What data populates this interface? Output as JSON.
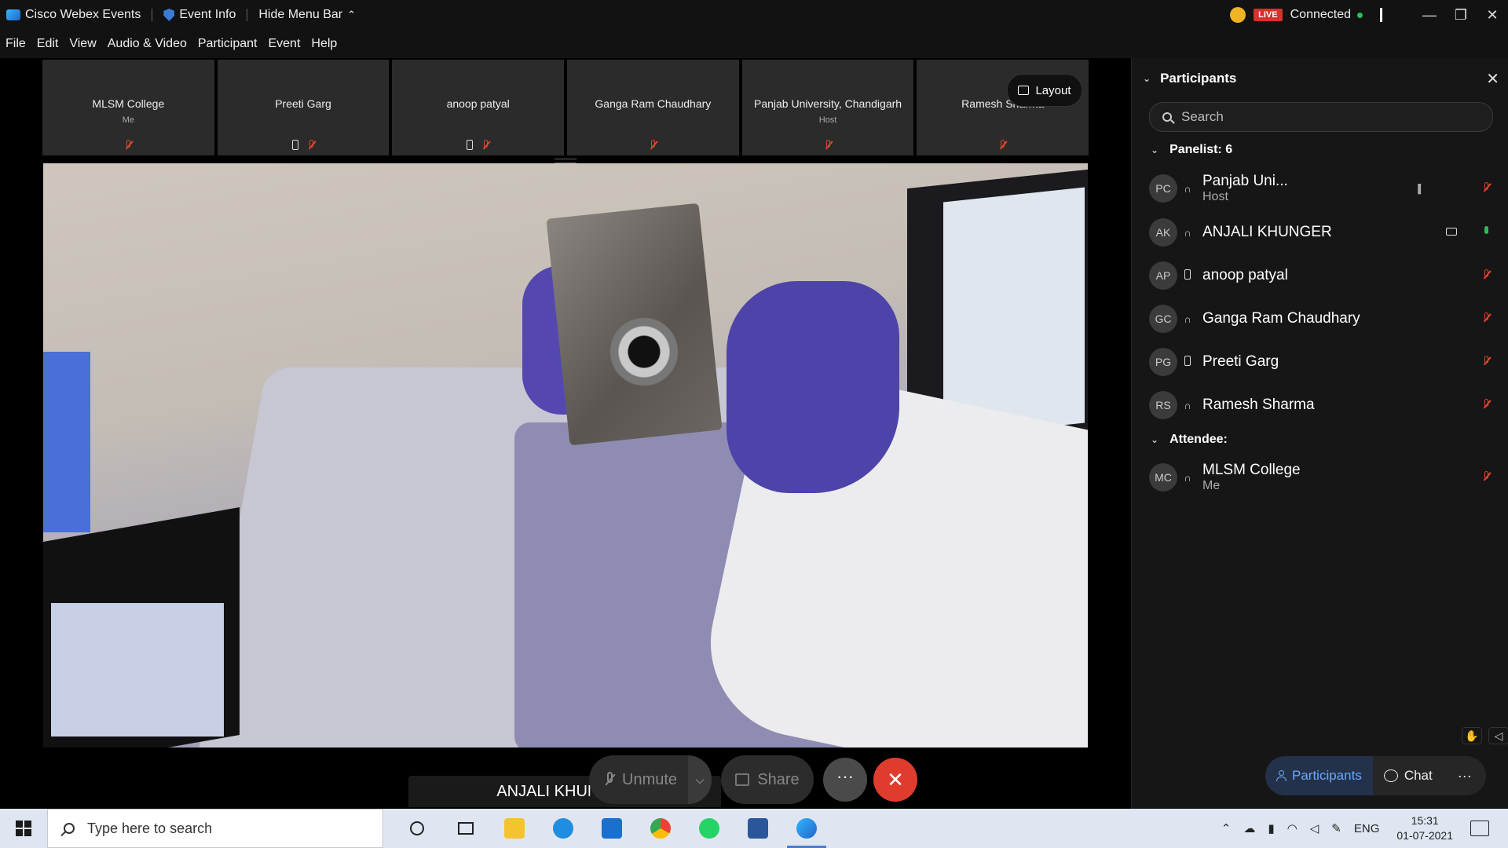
{
  "titlebar": {
    "app_name": "Cisco Webex Events",
    "event_info": "Event Info",
    "hide_menu": "Hide Menu Bar",
    "live": "LIVE",
    "status": "Connected",
    "minimize": "—",
    "restore": "❐",
    "close": "✕"
  },
  "menu": [
    "File",
    "Edit",
    "View",
    "Audio & Video",
    "Participant",
    "Event",
    "Help"
  ],
  "thumbnails": [
    {
      "name": "MLSM College",
      "sub": "Me",
      "phone": false
    },
    {
      "name": "Preeti Garg",
      "sub": "",
      "phone": true
    },
    {
      "name": "anoop patyal",
      "sub": "",
      "phone": true
    },
    {
      "name": "Ganga Ram Chaudhary",
      "sub": "",
      "phone": false
    },
    {
      "name": "Panjab University, Chandigarh",
      "sub": "Host",
      "phone": false
    },
    {
      "name": "Ramesh Sharma",
      "sub": "",
      "phone": false
    }
  ],
  "layout_label": "Layout",
  "active_speaker": "ANJALI KHUNGER",
  "controls": {
    "unmute": "Unmute",
    "share": "Share",
    "more": "···",
    "leave": "✕"
  },
  "panel": {
    "title": "Participants",
    "search_placeholder": "Search",
    "panelist_header": "Panelist: 6",
    "attendee_header": "Attendee:",
    "panelists": [
      {
        "initials": "PC",
        "name": "Panjab Uni...",
        "sub": "Host"
      },
      {
        "initials": "AK",
        "name": "ANJALI KHUNGER",
        "sub": ""
      },
      {
        "initials": "AP",
        "name": "anoop patyal",
        "sub": ""
      },
      {
        "initials": "GC",
        "name": "Ganga Ram Chaudhary",
        "sub": ""
      },
      {
        "initials": "PG",
        "name": "Preeti Garg",
        "sub": ""
      },
      {
        "initials": "RS",
        "name": "Ramesh Sharma",
        "sub": ""
      }
    ],
    "attendees": [
      {
        "initials": "MC",
        "name": "MLSM College",
        "sub": "Me"
      }
    ],
    "tab_participants": "Participants",
    "tab_chat": "Chat",
    "tab_more": "···"
  },
  "taskbar": {
    "search_placeholder": "Type here to search",
    "lang": "ENG",
    "time": "15:31",
    "date": "01-07-2021"
  },
  "colors": {
    "accent": "#6aa8ff",
    "leave": "#e03c2e",
    "muted": "#e0452f",
    "live": "#d9302c",
    "connected": "#2dbd57"
  }
}
